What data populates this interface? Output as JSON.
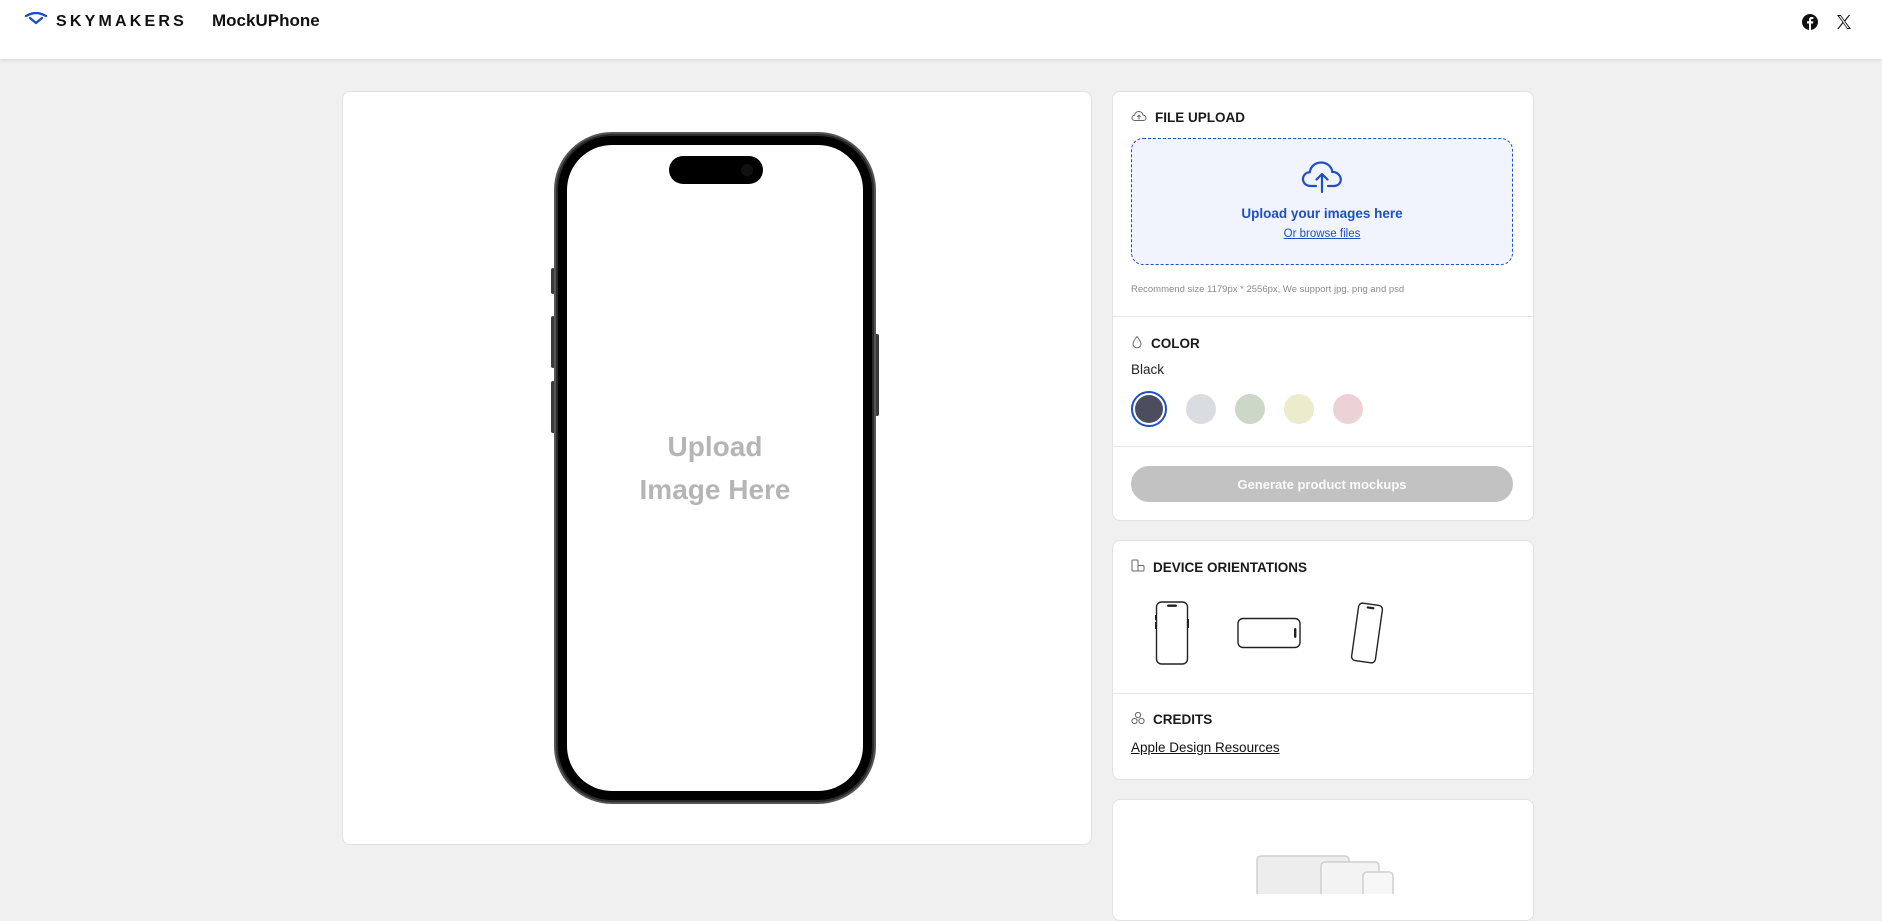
{
  "header": {
    "brand": "SKYMAKERS",
    "product": "MockUPhone",
    "social": [
      "facebook-icon",
      "x-icon"
    ]
  },
  "preview": {
    "placeholder_line1": "Upload",
    "placeholder_line2": "Image Here"
  },
  "upload": {
    "title": "FILE UPLOAD",
    "drop_title": "Upload your images here",
    "browse": "Or browse files",
    "hint": "Recommend size 1179px * 2556px, We support jpg, png and psd"
  },
  "color": {
    "title": "COLOR",
    "selected": "Black",
    "swatches": [
      "#4a4e5e",
      "#d9dde2",
      "#ccd7c8",
      "#ecebcb",
      "#ecd2d6"
    ]
  },
  "generate": {
    "label": "Generate product mockups"
  },
  "orientations": {
    "title": "DEVICE ORIENTATIONS"
  },
  "credits": {
    "title": "CREDITS",
    "link": "Apple Design Resources"
  },
  "accent": "#1f4fc4"
}
